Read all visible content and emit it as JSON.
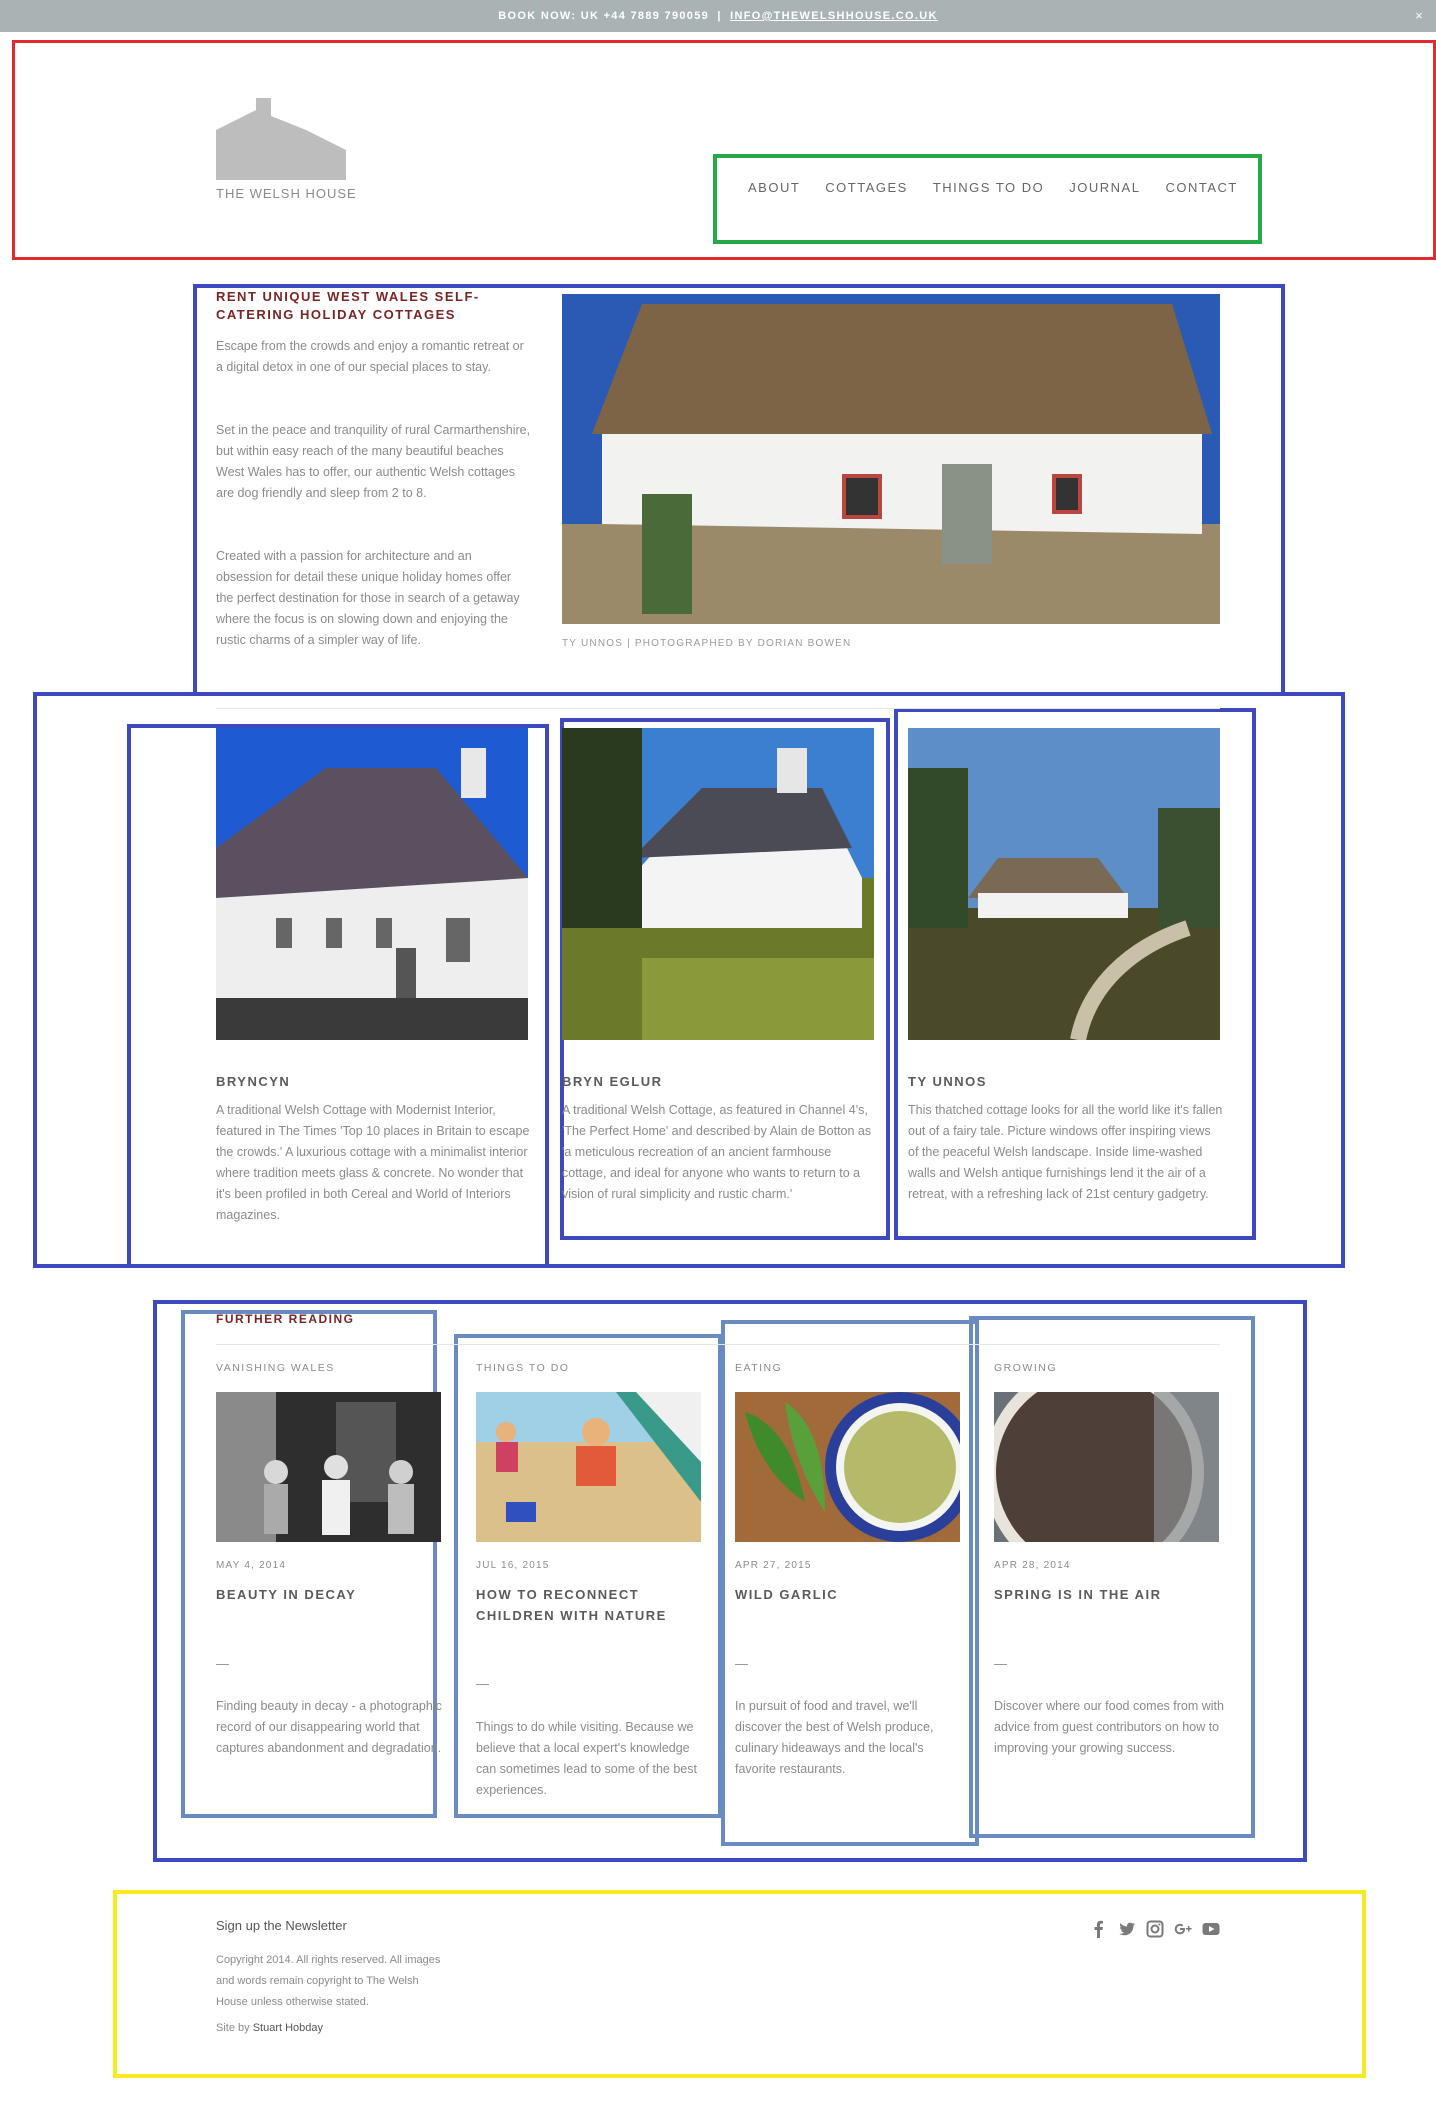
{
  "topbar": {
    "book_now": "BOOK NOW: UK +44 7889 790059",
    "separator": "|",
    "email": "INFO@THEWELSHHOUSE.CO.UK",
    "close_glyph": "×",
    "background": "#a9b3b3"
  },
  "header": {
    "logo_text": "THE WELSH HOUSE",
    "nav": [
      "ABOUT",
      "COTTAGES",
      "THINGS TO DO",
      "JOURNAL",
      "CONTACT"
    ]
  },
  "intro": {
    "title": "RENT UNIQUE WEST WALES SELF-CATERING HOLIDAY COTTAGES",
    "paragraphs": [
      "Escape from the crowds and enjoy a romantic retreat or a digital detox in one of our special places to stay.",
      "Set in the peace and tranquility of rural Carmarthenshire, but within easy reach of the many beautiful beaches West Wales has to offer, our authentic Welsh cottages are dog friendly and sleep from 2 to 8.",
      "Created with a passion for architecture and an obsession for detail these unique holiday homes offer the perfect destination for those in search of a getaway where the focus is on slowing down and enjoying the rustic charms of a simpler way of life."
    ],
    "caption": "TY UNNOS | PHOTOGRAPHED BY DORIAN BOWEN"
  },
  "cottages": [
    {
      "name": "BRYNCYN",
      "description": "A traditional Welsh Cottage with Modernist Interior, featured in The Times 'Top 10 places in Britain to escape the crowds.' A luxurious cottage with a minimalist interior where tradition meets glass & concrete. No wonder that it's been profiled in both Cereal and World of Interiors magazines."
    },
    {
      "name": "BRYN EGLUR",
      "description": "A traditional Welsh Cottage, as featured in Channel 4's, 'The Perfect Home' and described by Alain de Botton as 'a meticulous recreation of an ancient farmhouse cottage, and ideal for anyone who wants to return to a vision of rural simplicity and rustic charm.'"
    },
    {
      "name": "TY UNNOS",
      "description": "This thatched cottage looks for all the world like it's fallen out of a fairy tale. Picture windows offer inspiring views of the peaceful Welsh landscape. Inside lime-washed walls and Welsh antique furnishings lend it the air of a retreat, with a refreshing lack of 21st century gadgetry."
    }
  ],
  "further_reading": {
    "heading": "FURTHER READING",
    "posts": [
      {
        "category": "VANISHING WALES",
        "date": "MAY 4, 2014",
        "title": "BEAUTY IN DECAY",
        "dash": "—",
        "description": "Finding beauty in decay - a photographic record of our disappearing world that captures abandonment and degradation."
      },
      {
        "category": "THINGS TO DO",
        "date": "JUL 16, 2015",
        "title": "HOW TO RECONNECT CHILDREN WITH NATURE",
        "dash": "—",
        "description": "Things to do while visiting. Because we believe that a local expert's knowledge can sometimes lead to some of the best experiences."
      },
      {
        "category": "EATING",
        "date": "APR 27, 2015",
        "title": "WILD GARLIC",
        "dash": "—",
        "description": "In pursuit of food and travel, we'll discover the best of Welsh produce, culinary hideaways and the local's favorite restaurants."
      },
      {
        "category": "GROWING",
        "date": "APR 28, 2014",
        "title": "SPRING IS IN THE AIR",
        "dash": "—",
        "description": "Discover where our food comes from with advice from guest contributors on how to improving your growing success."
      }
    ]
  },
  "footer": {
    "newsletter": "Sign up the Newsletter",
    "copyright": "Copyright 2014. All rights reserved. All images and words remain copyright to The Welsh House unless otherwise stated.",
    "site_by_prefix": "Site by",
    "site_by_name": "Stuart Hobday",
    "social_icons": [
      "facebook-icon",
      "twitter-icon",
      "instagram-icon",
      "google-plus-icon",
      "youtube-icon"
    ]
  },
  "colors": {
    "accent": "#7a2424",
    "highlight_red": "#e02a2f",
    "highlight_green": "#26a844",
    "highlight_blue": "#3e48bf",
    "highlight_light_blue": "#6a8bc2",
    "highlight_yellow": "#f7ea21"
  }
}
